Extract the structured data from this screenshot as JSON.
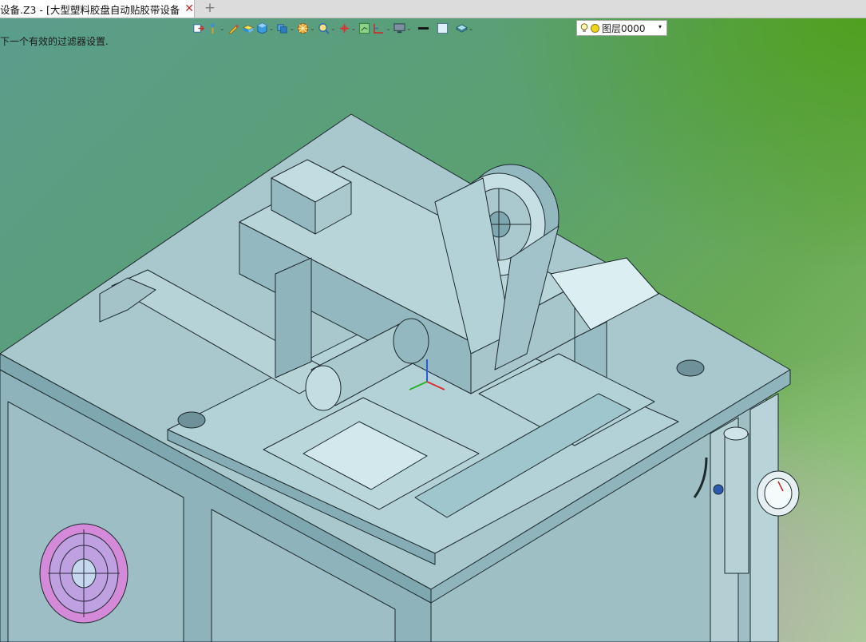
{
  "window": {
    "tab_title": "设备.Z3 - [大型塑料胶盘自动贴胶带设备]",
    "close_glyph": "✕",
    "add_tab_glyph": "+"
  },
  "viewport": {
    "hint_text": "下一个有效的过滤器设置."
  },
  "toolbar": {
    "items": [
      {
        "name": "exit-sketch-icon",
        "has_dropdown": false
      },
      {
        "name": "pick-filter-icon",
        "has_dropdown": true
      },
      {
        "name": "pencil-icon",
        "has_dropdown": false
      },
      {
        "name": "shaded-block-icon",
        "has_dropdown": false
      },
      {
        "name": "cube-icon",
        "has_dropdown": true
      },
      {
        "name": "view-cube-icon",
        "has_dropdown": true
      },
      {
        "name": "render-mode-icon",
        "has_dropdown": true
      },
      {
        "name": "zoom-icon",
        "has_dropdown": true
      },
      {
        "name": "triad-icon",
        "has_dropdown": true
      },
      {
        "name": "grid-icon",
        "has_dropdown": false
      },
      {
        "name": "ruler-icon",
        "has_dropdown": true
      },
      {
        "name": "display-icon",
        "has_dropdown": true
      },
      {
        "name": "line-style-icon",
        "has_dropdown": false
      },
      {
        "name": "color-swatch-icon",
        "has_dropdown": false
      },
      {
        "name": "layer-stack-icon",
        "has_dropdown": true
      }
    ],
    "dropdown_glyph": "⌄"
  },
  "layer_control": {
    "value": "图层0000",
    "arrow": "▾"
  },
  "colors": {
    "part_fill": "#9fc5cd",
    "part_dark": "#7ea7b0",
    "part_light": "#c2dde2",
    "edge": "#1c2a2e",
    "accent_bulb": "#f1d51c"
  }
}
